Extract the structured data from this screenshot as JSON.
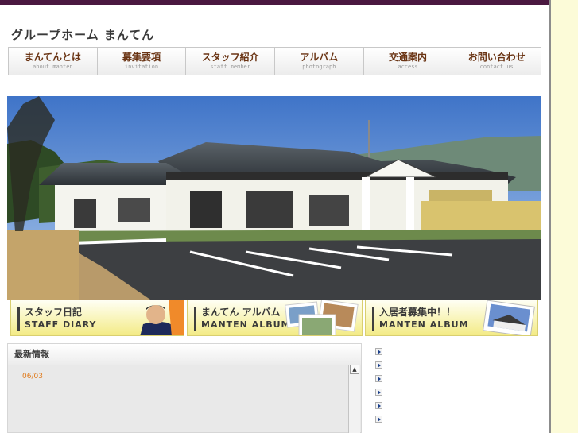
{
  "site": {
    "title": "グループホーム まんてん"
  },
  "nav": [
    {
      "label": "まんてんとは",
      "sub": "about manten"
    },
    {
      "label": "募集要項",
      "sub": "invitation"
    },
    {
      "label": "スタッフ紹介",
      "sub": "staff member"
    },
    {
      "label": "アルバム",
      "sub": "photograph"
    },
    {
      "label": "交通案内",
      "sub": "access"
    },
    {
      "label": "お問い合わせ",
      "sub": "contact us"
    }
  ],
  "banners": [
    {
      "title": "スタッフ日記",
      "subtitle": "STAFF DIARY"
    },
    {
      "title": "まんてん アルバム",
      "subtitle": "MANTEN ALBUM"
    },
    {
      "title": "入居者募集中！！",
      "subtitle": "MANTEN ALBUM"
    }
  ],
  "news": {
    "heading": "最新情報",
    "date": "06/03",
    "scroll_icon": "scroll-up-arrow"
  },
  "colors": {
    "top_bar": "#4a1840",
    "nav_text": "#6a3414",
    "banner_yellow": "#f3eb86",
    "news_date": "#e07a1a",
    "side_panel": "#fcfbd8"
  }
}
